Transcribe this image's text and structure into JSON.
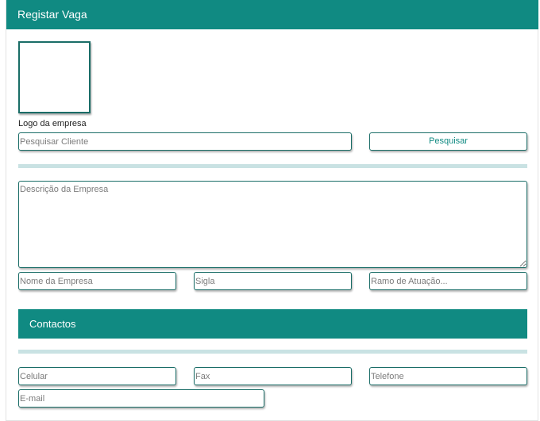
{
  "header": {
    "title": "Registar Vaga"
  },
  "logo": {
    "label": "Logo da empresa"
  },
  "search": {
    "placeholder": "Pesquisar Cliente",
    "button_label": "Pesquisar"
  },
  "company": {
    "description_placeholder": "Descrição da Empresa",
    "name_placeholder": "Nome da Empresa",
    "acronym_placeholder": "Sigla",
    "sector_placeholder": "Ramo de Atuação..."
  },
  "contacts": {
    "title": "Contactos",
    "mobile_placeholder": "Celular",
    "fax_placeholder": "Fax",
    "phone_placeholder": "Telefone",
    "email_placeholder": "E-mail"
  },
  "colors": {
    "accent": "#108a82",
    "border": "#1a6d67",
    "divider": "#c9e2e3"
  }
}
